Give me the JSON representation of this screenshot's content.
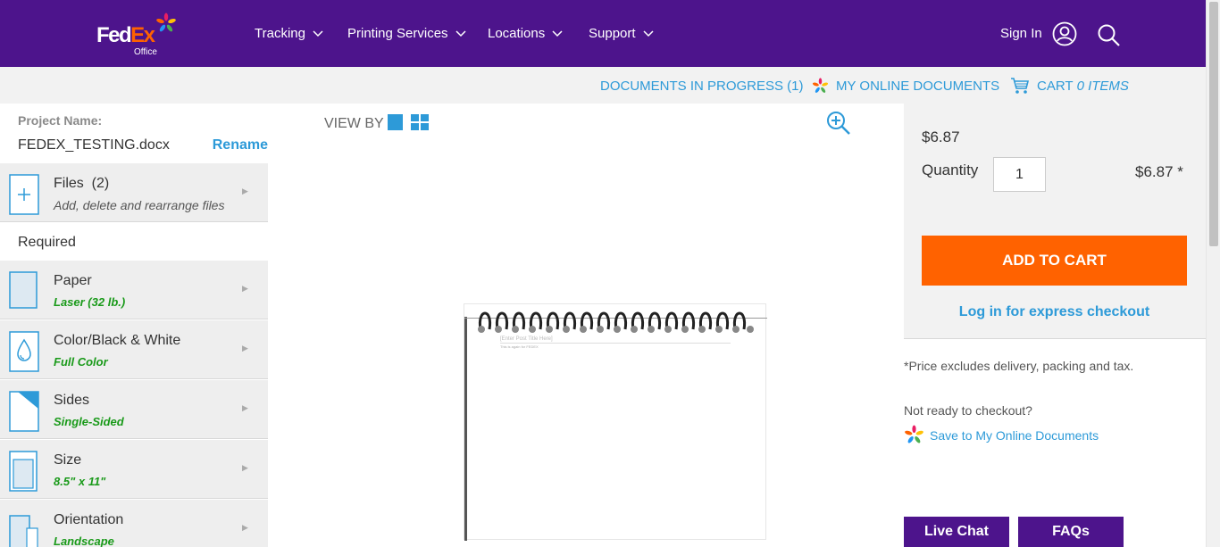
{
  "brand": {
    "name_part1": "Fed",
    "name_part2": "Ex",
    "sub": "Office"
  },
  "nav": {
    "items": [
      {
        "label": "Tracking"
      },
      {
        "label": "Printing Services"
      },
      {
        "label": "Locations"
      },
      {
        "label": "Support"
      }
    ],
    "sign_in": "Sign In"
  },
  "subbar": {
    "docs_in_progress": "DOCUMENTS IN PROGRESS (1)",
    "my_online_docs": "MY ONLINE DOCUMENTS",
    "cart_label": "CART",
    "cart_items": "0 ITEMS"
  },
  "project": {
    "label": "Project Name:",
    "name": "FEDEX_TESTING.docx",
    "rename": "Rename"
  },
  "files": {
    "title": "Files",
    "count": "(2)",
    "sub": "Add, delete and rearrange files"
  },
  "required_label": "Required",
  "options": [
    {
      "title": "Paper",
      "value": "Laser (32 lb.)"
    },
    {
      "title": "Color/Black & White",
      "value": "Full Color"
    },
    {
      "title": "Sides",
      "value": "Single-Sided"
    },
    {
      "title": "Size",
      "value": "8.5\" x 11\""
    },
    {
      "title": "Orientation",
      "value": "Landscape"
    }
  ],
  "viewer": {
    "view_by": "VIEW BY",
    "doc_title": "[Enter Post Title Here]",
    "doc_text": "This is again for FEDEX"
  },
  "pricing": {
    "price": "$6.87",
    "quantity_label": "Quantity",
    "quantity_value": "1",
    "total": "$6.87 *",
    "add_to_cart": "ADD TO CART",
    "express": "Log in for express checkout",
    "disclaimer": "*Price excludes delivery, packing and tax.",
    "not_ready": "Not ready to checkout?",
    "save_link": "Save to My Online Documents"
  },
  "help": {
    "live_chat": "Live Chat",
    "faqs": "FAQs"
  },
  "colors": {
    "purple": "#4d148c",
    "orange": "#ff6200",
    "blue": "#2d9ad8",
    "green": "#1a9a1a"
  }
}
